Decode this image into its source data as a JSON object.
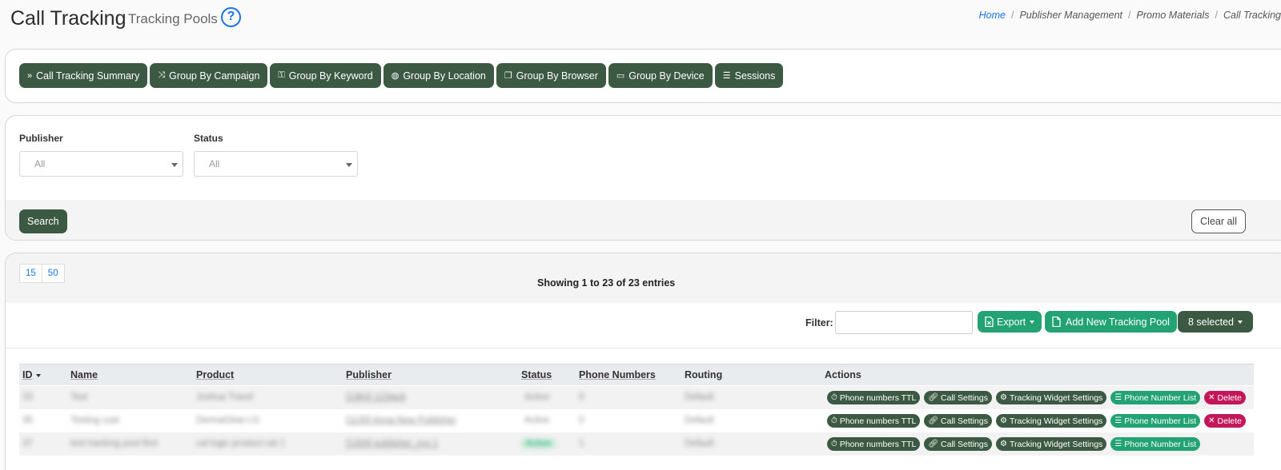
{
  "header": {
    "title": "Call Tracking",
    "subtitle": "Tracking Pools",
    "help_glyph": "?",
    "breadcrumb": [
      "Home",
      "Publisher Management",
      "Promo Materials",
      "Call Tracking"
    ]
  },
  "tabs": [
    {
      "icon": "»",
      "label": "Call Tracking Summary"
    },
    {
      "icon": "⤨",
      "label": "Group By Campaign"
    },
    {
      "icon": "⚿",
      "label": "Group By Keyword"
    },
    {
      "icon": "◍",
      "label": "Group By Location"
    },
    {
      "icon": "❐",
      "label": "Group By Browser"
    },
    {
      "icon": "▭",
      "label": "Group By Device"
    },
    {
      "icon": "☰",
      "label": "Sessions"
    }
  ],
  "filters": {
    "publisher": {
      "label": "Publisher",
      "value": "All"
    },
    "status": {
      "label": "Status",
      "value": "All"
    },
    "search_label": "Search",
    "clear_label": "Clear all"
  },
  "table_controls": {
    "page_sizes": [
      "15",
      "50"
    ],
    "showing": "Showing 1 to 23 of 23 entries",
    "filter_label": "Filter:",
    "export_label": "Export",
    "add_label": "Add New Tracking Pool",
    "selected_label": "8 selected"
  },
  "table": {
    "columns": [
      "ID",
      "Name",
      "Product",
      "Publisher",
      "Status",
      "Phone Numbers",
      "Routing",
      "Actions"
    ],
    "rows": [
      {
        "id": "33",
        "name": "Test",
        "product": "Joshua Travel",
        "publisher": "[1363] 123jack",
        "status": "Active",
        "phones": "0",
        "routing": "Default",
        "delete": true
      },
      {
        "id": "35",
        "name": "Testing cust",
        "product": "DermaGlow LG",
        "publisher": "[1130] Anna New Publisher",
        "status": "Active",
        "phones": "0",
        "routing": "Default",
        "delete": true
      },
      {
        "id": "37",
        "name": "test tracking pool first",
        "product": "cal logic product cat 1",
        "publisher": "[1304] publisher_xyz 1",
        "status": "Active",
        "phones": "1",
        "routing": "Default",
        "delete": false
      }
    ],
    "action_labels": {
      "ttl": "Phone numbers TTL",
      "call": "Call Settings",
      "widget": "Tracking Widget Settings",
      "list": "Phone Number List",
      "delete": "Delete"
    }
  },
  "colors": {
    "dark_green": "#3c5a43",
    "green": "#23a373",
    "pink": "#c2185b",
    "link_blue": "#1a73e8"
  }
}
